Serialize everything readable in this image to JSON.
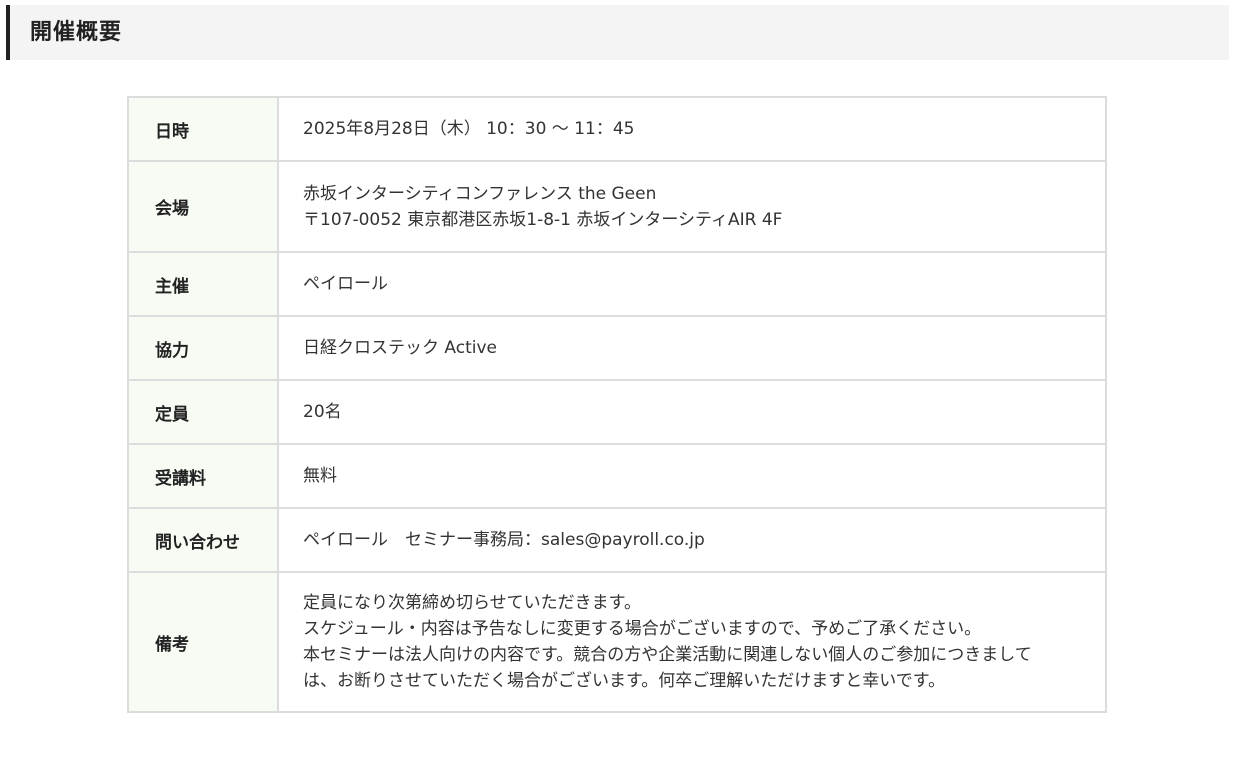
{
  "heading": {
    "title": "開催概要"
  },
  "rows": [
    {
      "label": "日時",
      "lines": [
        "2025年8月28日（木） 10：30 ～ 11：45"
      ]
    },
    {
      "label": "会場",
      "lines": [
        "赤坂インターシティコンファレンス the Geen",
        "〒107-0052 東京都港区赤坂1-8-1 赤坂インターシティAIR 4F"
      ]
    },
    {
      "label": "主催",
      "lines": [
        "ペイロール"
      ]
    },
    {
      "label": "協力",
      "lines": [
        "日経クロステック Active"
      ]
    },
    {
      "label": "定員",
      "lines": [
        "20名"
      ]
    },
    {
      "label": "受講料",
      "lines": [
        "無料"
      ]
    },
    {
      "label": "問い合わせ",
      "lines": [
        "ペイロール　セミナー事務局：sales@payroll.co.jp"
      ]
    },
    {
      "label": "備考",
      "lines": [
        "定員になり次第締め切らせていただきます。",
        "スケジュール・内容は予告なしに変更する場合がございますので、予めご了承ください。",
        "本セミナーは法人向けの内容です。競合の方や企業活動に関連しない個人のご参加につきましては、お断りさせていただく場合がございます。何卒ご理解いただけますと幸いです。"
      ]
    }
  ],
  "colors": {
    "label_bg": "#f6fbf3",
    "border": "#dcdcdc",
    "heading_bg": "#f4f4f4",
    "heading_accent": "#222222"
  }
}
